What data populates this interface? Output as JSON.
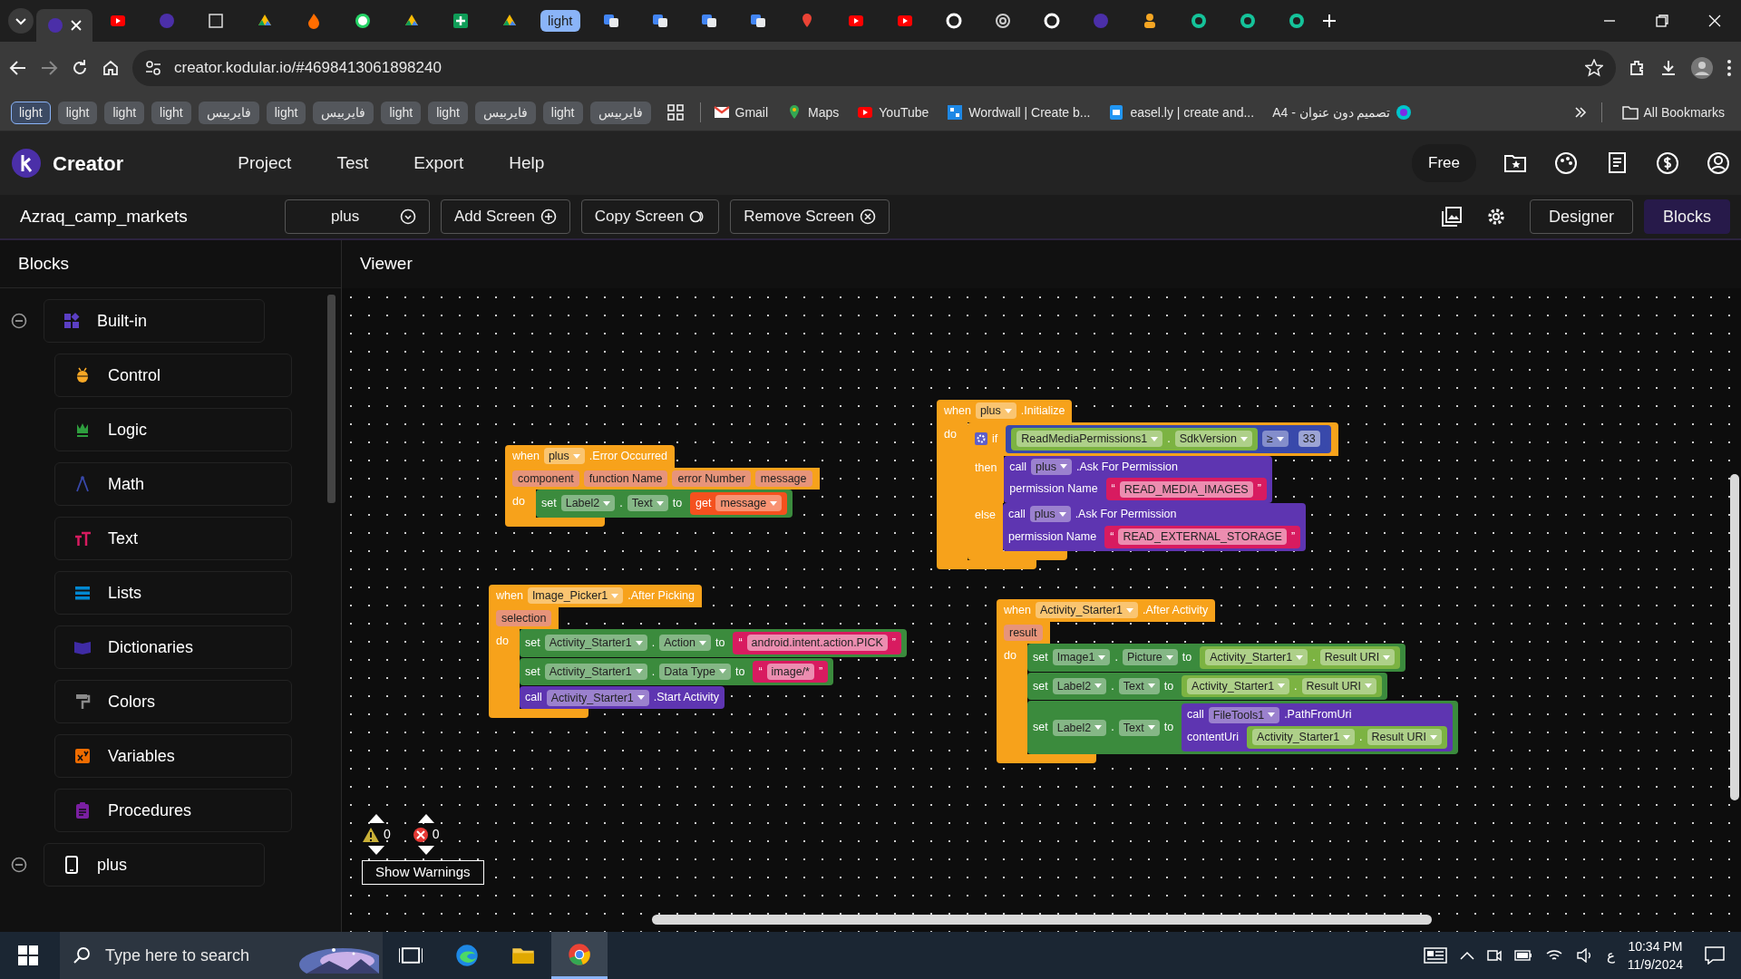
{
  "browser": {
    "tabs": [
      {
        "kind": "kodular",
        "selected": true
      },
      {
        "kind": "youtube",
        "selected": false
      },
      {
        "kind": "kodular",
        "selected": false
      },
      {
        "kind": "notion",
        "selected": false
      },
      {
        "kind": "drive",
        "selected": false
      },
      {
        "kind": "fire",
        "selected": false
      },
      {
        "kind": "whatsapp",
        "selected": false
      },
      {
        "kind": "drive",
        "selected": false
      },
      {
        "kind": "sheets",
        "selected": false
      },
      {
        "kind": "drive",
        "selected": false
      },
      {
        "kind": "group",
        "text": "light",
        "selected": false
      },
      {
        "kind": "translate",
        "selected": false
      },
      {
        "kind": "translate",
        "selected": false
      },
      {
        "kind": "translate",
        "selected": false
      },
      {
        "kind": "translate",
        "selected": false
      },
      {
        "kind": "pin",
        "selected": false
      },
      {
        "kind": "youtube",
        "selected": false
      },
      {
        "kind": "youtube",
        "selected": false
      },
      {
        "kind": "google",
        "selected": false
      },
      {
        "kind": "openai",
        "selected": false
      },
      {
        "kind": "google",
        "selected": false
      },
      {
        "kind": "kodular",
        "selected": false
      },
      {
        "kind": "person",
        "selected": false
      },
      {
        "kind": "grammarly",
        "selected": false
      },
      {
        "kind": "grammarly",
        "selected": false
      },
      {
        "kind": "grammarly",
        "selected": false
      }
    ],
    "address": "creator.kodular.io/#4698413061898240",
    "bookmarks": [
      {
        "kind": "chip",
        "text": "light",
        "selected": true
      },
      {
        "kind": "chip",
        "text": "light",
        "selected": false
      },
      {
        "kind": "chip",
        "text": "light",
        "selected": false
      },
      {
        "kind": "chip",
        "text": "light",
        "selected": false
      },
      {
        "kind": "chip",
        "text": "فايربيس",
        "selected": false
      },
      {
        "kind": "chip",
        "text": "light",
        "selected": false
      },
      {
        "kind": "chip",
        "text": "فايربيس",
        "selected": false
      },
      {
        "kind": "chip",
        "text": "light",
        "selected": false
      },
      {
        "kind": "chip",
        "text": "light",
        "selected": false
      },
      {
        "kind": "chip",
        "text": "فايربيس",
        "selected": false
      },
      {
        "kind": "chip",
        "text": "light",
        "selected": false
      },
      {
        "kind": "chip",
        "text": "فايربيس",
        "selected": false
      },
      {
        "kind": "apps"
      },
      {
        "kind": "gmail",
        "text": "Gmail"
      },
      {
        "kind": "maps",
        "text": "Maps"
      },
      {
        "kind": "youtube",
        "text": "YouTube"
      },
      {
        "kind": "wordwall",
        "text": "Wordwall | Create b..."
      },
      {
        "kind": "easelly",
        "text": "easel.ly | create and..."
      },
      {
        "kind": "canva",
        "text": "تصميم دون عنوان - A4"
      }
    ],
    "all_bookmarks": "All Bookmarks"
  },
  "app": {
    "brand": "Creator",
    "menu": [
      "Project",
      "Test",
      "Export",
      "Help"
    ],
    "plan": "Free",
    "project": "Azraq_camp_markets",
    "screen": "plus",
    "screen_actions": [
      {
        "kind": "add",
        "label": "Add Screen"
      },
      {
        "kind": "copy",
        "label": "Copy Screen"
      },
      {
        "kind": "remove",
        "label": "Remove Screen"
      }
    ],
    "modes": [
      {
        "label": "Designer",
        "selected": false
      },
      {
        "label": "Blocks",
        "selected": true
      }
    ]
  },
  "sidebar": {
    "title": "Blocks",
    "tree": [
      {
        "label": "Built-in",
        "kind": "builtin",
        "expanded": true,
        "children": [
          {
            "label": "Control",
            "kind": "control"
          },
          {
            "label": "Logic",
            "kind": "logic"
          },
          {
            "label": "Math",
            "kind": "math"
          },
          {
            "label": "Text",
            "kind": "text"
          },
          {
            "label": "Lists",
            "kind": "lists"
          },
          {
            "label": "Dictionaries",
            "kind": "dictionaries"
          },
          {
            "label": "Colors",
            "kind": "colors"
          },
          {
            "label": "Variables",
            "kind": "variables"
          },
          {
            "label": "Procedures",
            "kind": "procedures"
          }
        ]
      },
      {
        "label": "plus",
        "kind": "screen",
        "expanded": true
      }
    ]
  },
  "viewer": {
    "title": "Viewer",
    "blocks": [
      {
        "kind": "event",
        "rows": [
          {
            "label": [
              {
                "kind": "word",
                "text": "when"
              },
              {
                "kind": "dropdown",
                "text": "plus"
              },
              {
                "kind": "word",
                "text": ".Error Occurred"
              }
            ]
          },
          {
            "label": [
              {
                "kind": "param",
                "text": "component"
              },
              {
                "kind": "param",
                "text": "function Name"
              },
              {
                "kind": "param",
                "text": "error Number"
              },
              {
                "kind": "param",
                "text": "message"
              }
            ]
          },
          {
            "label": [
              {
                "kind": "word",
                "text": "do"
              }
            ],
            "stack": [
              {
                "kind": "set",
                "rows": [
                  {
                    "label": [
                      {
                        "kind": "word",
                        "text": "set"
                      },
                      {
                        "kind": "dropdown",
                        "text": "Label2"
                      },
                      {
                        "kind": "word",
                        "text": "."
                      },
                      {
                        "kind": "dropdown",
                        "text": "Text"
                      },
                      {
                        "kind": "word",
                        "text": "to"
                      }
                    ],
                    "input": {
                      "kind": "variable",
                      "rows": [
                        {
                          "label": [
                            {
                              "kind": "word",
                              "text": "get"
                            },
                            {
                              "kind": "dropdown",
                              "text": "message"
                            }
                          ]
                        }
                      ]
                    }
                  }
                ]
              }
            ]
          }
        ]
      },
      {
        "kind": "event",
        "rows": [
          {
            "label": [
              {
                "kind": "word",
                "text": "when"
              },
              {
                "kind": "dropdown",
                "text": "plus"
              },
              {
                "kind": "word",
                "text": ".Initialize"
              }
            ]
          },
          {
            "label": [
              {
                "kind": "word",
                "text": "do"
              }
            ],
            "stack": [
              {
                "kind": "control",
                "rows": [
                  {
                    "label": [
                      {
                        "kind": "mutator"
                      },
                      {
                        "kind": "word",
                        "text": "if"
                      }
                    ],
                    "input": {
                      "kind": "compare",
                      "rows": [
                        {
                          "label": [
                            {
                              "kind": "block",
                              "block": {
                                "kind": "getter",
                                "rows": [
                                  {
                                    "label": [
                                      {
                                        "kind": "dropdown",
                                        "text": "ReadMediaPermissions1"
                                      },
                                      {
                                        "kind": "word",
                                        "text": "."
                                      },
                                      {
                                        "kind": "dropdown",
                                        "text": "SdkVersion"
                                      }
                                    ]
                                  }
                                ]
                              }
                            },
                            {
                              "kind": "dropdown",
                              "text": "≥"
                            },
                            {
                              "kind": "block",
                              "block": {
                                "kind": "number",
                                "rows": [
                                  {
                                    "label": [
                                      {
                                        "kind": "value",
                                        "text": "33"
                                      }
                                    ]
                                  }
                                ]
                              }
                            }
                          ]
                        }
                      ]
                    }
                  },
                  {
                    "label": [
                      {
                        "kind": "word",
                        "text": "then"
                      }
                    ],
                    "stack": [
                      {
                        "kind": "call",
                        "rows": [
                          {
                            "label": [
                              {
                                "kind": "word",
                                "text": "call"
                              },
                              {
                                "kind": "dropdown",
                                "text": "plus"
                              },
                              {
                                "kind": "word",
                                "text": ".Ask For Permission"
                              }
                            ]
                          },
                          {
                            "label": [
                              {
                                "kind": "word",
                                "text": "permission Name"
                              }
                            ],
                            "input": {
                              "kind": "string",
                              "rows": [
                                {
                                  "label": [
                                    {
                                      "kind": "word",
                                      "text": "“"
                                    },
                                    {
                                      "kind": "value",
                                      "text": "READ_MEDIA_IMAGES"
                                    },
                                    {
                                      "kind": "word",
                                      "text": "”"
                                    }
                                  ]
                                }
                              ]
                            }
                          }
                        ]
                      }
                    ]
                  },
                  {
                    "label": [
                      {
                        "kind": "word",
                        "text": "else"
                      }
                    ],
                    "stack": [
                      {
                        "kind": "call",
                        "rows": [
                          {
                            "label": [
                              {
                                "kind": "word",
                                "text": "call"
                              },
                              {
                                "kind": "dropdown",
                                "text": "plus"
                              },
                              {
                                "kind": "word",
                                "text": ".Ask For Permission"
                              }
                            ]
                          },
                          {
                            "label": [
                              {
                                "kind": "word",
                                "text": "permission Name"
                              }
                            ],
                            "input": {
                              "kind": "string",
                              "rows": [
                                {
                                  "label": [
                                    {
                                      "kind": "word",
                                      "text": "“"
                                    },
                                    {
                                      "kind": "value",
                                      "text": "READ_EXTERNAL_STORAGE"
                                    },
                                    {
                                      "kind": "word",
                                      "text": "”"
                                    }
                                  ]
                                }
                              ]
                            }
                          }
                        ]
                      }
                    ]
                  }
                ]
              }
            ]
          }
        ]
      },
      {
        "kind": "event",
        "rows": [
          {
            "label": [
              {
                "kind": "word",
                "text": "when"
              },
              {
                "kind": "dropdown",
                "text": "Image_Picker1"
              },
              {
                "kind": "word",
                "text": ".After Picking"
              }
            ]
          },
          {
            "label": [
              {
                "kind": "param",
                "text": "selection"
              }
            ]
          },
          {
            "label": [
              {
                "kind": "word",
                "text": "do"
              }
            ],
            "stack": [
              {
                "kind": "set",
                "rows": [
                  {
                    "label": [
                      {
                        "kind": "word",
                        "text": "set"
                      },
                      {
                        "kind": "dropdown",
                        "text": "Activity_Starter1"
                      },
                      {
                        "kind": "word",
                        "text": "."
                      },
                      {
                        "kind": "dropdown",
                        "text": "Action"
                      },
                      {
                        "kind": "word",
                        "text": "to"
                      }
                    ],
                    "input": {
                      "kind": "string",
                      "rows": [
                        {
                          "label": [
                            {
                              "kind": "word",
                              "text": "“"
                            },
                            {
                              "kind": "value",
                              "text": "android.intent.action.PICK"
                            },
                            {
                              "kind": "word",
                              "text": "”"
                            }
                          ]
                        }
                      ]
                    }
                  }
                ]
              },
              {
                "kind": "set",
                "rows": [
                  {
                    "label": [
                      {
                        "kind": "word",
                        "text": "set"
                      },
                      {
                        "kind": "dropdown",
                        "text": "Activity_Starter1"
                      },
                      {
                        "kind": "word",
                        "text": "."
                      },
                      {
                        "kind": "dropdown",
                        "text": "Data Type"
                      },
                      {
                        "kind": "word",
                        "text": "to"
                      }
                    ],
                    "input": {
                      "kind": "string",
                      "rows": [
                        {
                          "label": [
                            {
                              "kind": "word",
                              "text": "“"
                            },
                            {
                              "kind": "value",
                              "text": "image/*"
                            },
                            {
                              "kind": "word",
                              "text": "”"
                            }
                          ]
                        }
                      ]
                    }
                  }
                ]
              },
              {
                "kind": "call",
                "rows": [
                  {
                    "label": [
                      {
                        "kind": "word",
                        "text": "call"
                      },
                      {
                        "kind": "dropdown",
                        "text": "Activity_Starter1"
                      },
                      {
                        "kind": "word",
                        "text": ".Start Activity"
                      }
                    ]
                  }
                ]
              }
            ]
          }
        ]
      },
      {
        "kind": "event",
        "rows": [
          {
            "label": [
              {
                "kind": "word",
                "text": "when"
              },
              {
                "kind": "dropdown",
                "text": "Activity_Starter1"
              },
              {
                "kind": "word",
                "text": ".After Activity"
              }
            ]
          },
          {
            "label": [
              {
                "kind": "param",
                "text": "result"
              }
            ]
          },
          {
            "label": [
              {
                "kind": "word",
                "text": "do"
              }
            ],
            "stack": [
              {
                "kind": "set",
                "rows": [
                  {
                    "label": [
                      {
                        "kind": "word",
                        "text": "set"
                      },
                      {
                        "kind": "dropdown",
                        "text": "Image1"
                      },
                      {
                        "kind": "word",
                        "text": "."
                      },
                      {
                        "kind": "dropdown",
                        "text": "Picture"
                      },
                      {
                        "kind": "word",
                        "text": "to"
                      }
                    ],
                    "input": {
                      "kind": "getter",
                      "rows": [
                        {
                          "label": [
                            {
                              "kind": "dropdown",
                              "text": "Activity_Starter1"
                            },
                            {
                              "kind": "word",
                              "text": "."
                            },
                            {
                              "kind": "dropdown",
                              "text": "Result URI"
                            }
                          ]
                        }
                      ]
                    }
                  }
                ]
              },
              {
                "kind": "set",
                "rows": [
                  {
                    "label": [
                      {
                        "kind": "word",
                        "text": "set"
                      },
                      {
                        "kind": "dropdown",
                        "text": "Label2"
                      },
                      {
                        "kind": "word",
                        "text": "."
                      },
                      {
                        "kind": "dropdown",
                        "text": "Text"
                      },
                      {
                        "kind": "word",
                        "text": "to"
                      }
                    ],
                    "input": {
                      "kind": "getter",
                      "rows": [
                        {
                          "label": [
                            {
                              "kind": "dropdown",
                              "text": "Activity_Starter1"
                            },
                            {
                              "kind": "word",
                              "text": "."
                            },
                            {
                              "kind": "dropdown",
                              "text": "Result URI"
                            }
                          ]
                        }
                      ]
                    }
                  }
                ]
              },
              {
                "kind": "set",
                "rows": [
                  {
                    "label": [
                      {
                        "kind": "word",
                        "text": "set"
                      },
                      {
                        "kind": "dropdown",
                        "text": "Label2"
                      },
                      {
                        "kind": "word",
                        "text": "."
                      },
                      {
                        "kind": "dropdown",
                        "text": "Text"
                      },
                      {
                        "kind": "word",
                        "text": "to"
                      }
                    ],
                    "input": {
                      "kind": "call",
                      "rows": [
                        {
                          "label": [
                            {
                              "kind": "word",
                              "text": "call"
                            },
                            {
                              "kind": "dropdown",
                              "text": "FileTools1"
                            },
                            {
                              "kind": "word",
                              "text": ".PathFromUri"
                            }
                          ]
                        },
                        {
                          "label": [
                            {
                              "kind": "word",
                              "text": "contentUri"
                            }
                          ],
                          "input": {
                            "kind": "getter",
                            "rows": [
                              {
                                "label": [
                                  {
                                    "kind": "dropdown",
                                    "text": "Activity_Starter1"
                                  },
                                  {
                                    "kind": "word",
                                    "text": "."
                                  },
                                  {
                                    "kind": "dropdown",
                                    "text": "Result URI"
                                  }
                                ]
                              }
                            ]
                          }
                        }
                      ]
                    }
                  }
                ]
              }
            ]
          }
        ]
      }
    ],
    "warnings": {
      "warning_count": "0",
      "error_count": "0",
      "button": "Show Warnings"
    }
  },
  "taskbar": {
    "search_placeholder": "Type here to search",
    "language": "ع",
    "time": "10:34 PM",
    "date": "11/9/2024"
  }
}
